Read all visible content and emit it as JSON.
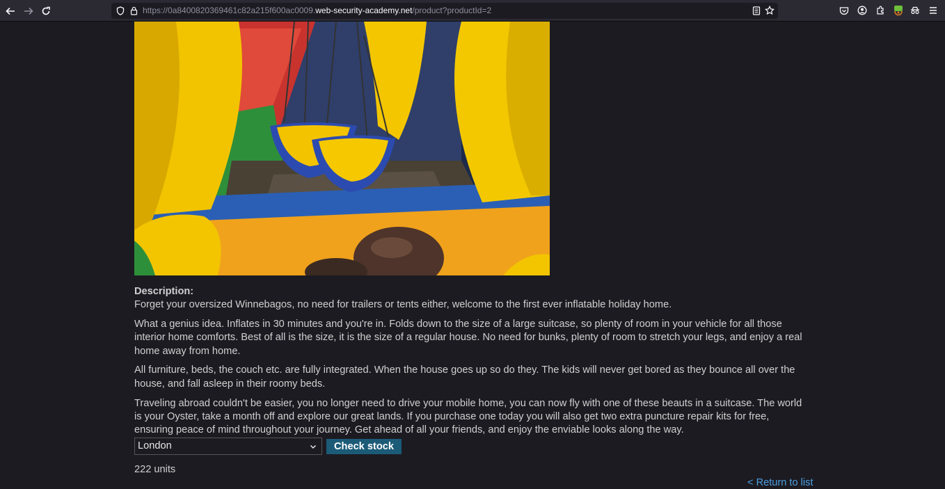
{
  "browser": {
    "url_prefix": "https://0a8400820369461c82a215f600ac0009.",
    "url_domain": "web-security-academy.net",
    "url_path": "/product?productId=2",
    "icons": {
      "back": "arrow-left-icon",
      "forward": "arrow-right-icon",
      "reload": "reload-icon",
      "tracking": "shield-icon",
      "lock": "lock-icon",
      "reader": "reader-view-icon",
      "bookmark": "star-icon",
      "pocket": "pocket-icon",
      "account": "account-icon",
      "extensions": "extensions-icon",
      "menu": "hamburger-menu-icon"
    }
  },
  "product": {
    "description_label": "Description:",
    "paragraphs": [
      "Forget your oversized Winnebagos, no need for trailers or tents either, welcome to the first ever inflatable holiday home.",
      "What a genius idea. Inflates in 30 minutes and you're in. Folds down to the size of a large suitcase, so plenty of room in your vehicle for all those interior home comforts. Best of all is the size, it is the size of a regular house. No need for bunks, plenty of room to stretch your legs, and enjoy a real home away from home.",
      "All furniture, beds, the couch etc. are fully integrated. When the house goes up so do they. The kids will never get bored as they bounce all over the house, and fall asleep in their roomy beds.",
      "Traveling abroad couldn't be easier, you no longer need to drive your mobile home, you can now fly with one of these beauts in a suitcase. The world is your Oyster, take a month off and explore our great lands. If you purchase one today you will also get two extra puncture repair kits for free, ensuring peace of mind throughout your journey. Get ahead of all your friends, and enjoy the enviable looks along the way."
    ]
  },
  "stock_form": {
    "selected_store": "London",
    "check_button_label": "Check stock",
    "result": "222 units"
  },
  "return_link": "< Return to list",
  "colors": {
    "page_bg": "#1c1b22",
    "button_bg": "#1b5b78",
    "link": "#4c9fe0"
  }
}
